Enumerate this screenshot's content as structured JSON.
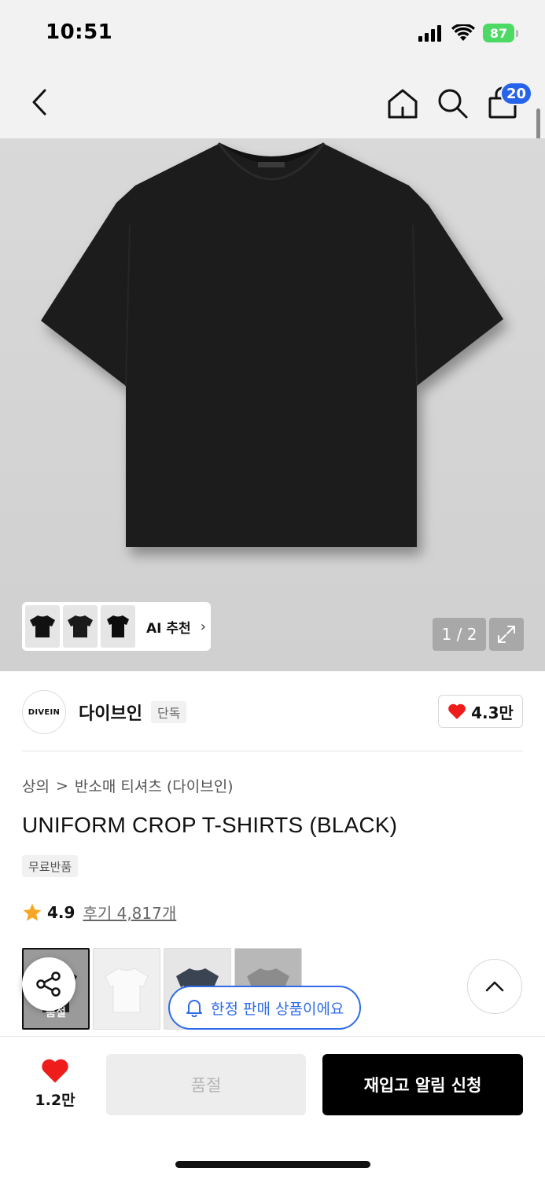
{
  "status": {
    "time": "10:51",
    "battery": "87"
  },
  "nav": {
    "cart_count": "20"
  },
  "gallery": {
    "ai_label": "AI 추천",
    "page": "1 / 2"
  },
  "brand": {
    "logo_text": "DIVEIN",
    "name": "다이브인",
    "tag": "단독",
    "likes": "4.3만"
  },
  "product": {
    "breadcrumb": [
      "상의",
      "반소매 티셔츠 (다이브인)"
    ],
    "title": "UNIFORM CROP T-SHIRTS (BLACK)",
    "badge": "무료반품",
    "rating": "4.9",
    "reviews": "후기 4,817개",
    "soldout_label": "품절"
  },
  "notice": {
    "limited": "한정 판매 상품이에요"
  },
  "bottom": {
    "wish_count": "1.2만",
    "soldout": "품절",
    "restock": "재입고 알림 신청"
  },
  "colors": {
    "heart": "#ef1c1c",
    "accent_blue": "#2f6be8",
    "badge_blue": "#2563eb",
    "battery_green": "#4cd964",
    "star": "#f5a623"
  }
}
